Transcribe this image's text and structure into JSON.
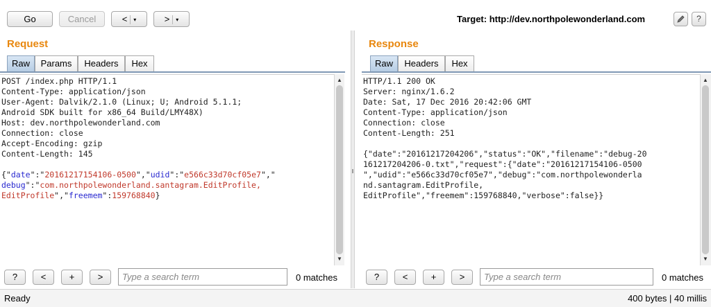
{
  "toolbar": {
    "go_label": "Go",
    "cancel_label": "Cancel",
    "back_label": "<",
    "forward_label": ">",
    "dropdown_glyph": "▾",
    "target_text": "Target: http://dev.northpolewonderland.com",
    "edit_icon": "pencil-icon",
    "help_glyph": "?"
  },
  "request": {
    "title": "Request",
    "tabs": [
      "Raw",
      "Params",
      "Headers",
      "Hex"
    ],
    "active_tab": "Raw",
    "lines": [
      "POST /index.php HTTP/1.1",
      "Content-Type: application/json",
      "User-Agent: Dalvik/2.1.0 (Linux; U; Android 5.1.1;",
      "Android SDK built for x86_64 Build/LMY48X)",
      "Host: dev.northpolewonderland.com",
      "Connection: close",
      "Accept-Encoding: gzip",
      "Content-Length: 145"
    ],
    "body_tokens": {
      "open": "{\"",
      "k_date": "date",
      "sep1": "\":\"",
      "v_date": "20161217154106-0500",
      "sep2": "\",\"",
      "k_udid": "udid",
      "sep3": "\":\"",
      "v_udid": "e566c33d70cf05e7",
      "sep4": "\",\"",
      "k_debug": "debug",
      "sep5": "\":\"",
      "v_debug_1": "com.northpolewonderland.santagram.EditProfile,",
      "v_debug_2": "EditProfile",
      "sep6": "\",\"",
      "k_freemem": "freemem",
      "sep7": "\":",
      "v_freemem": "159768840",
      "close": "}"
    },
    "search": {
      "help": "?",
      "prev": "<",
      "add": "+",
      "next": ">",
      "placeholder": "Type a search term",
      "matches": "0 matches"
    }
  },
  "response": {
    "title": "Response",
    "tabs": [
      "Raw",
      "Headers",
      "Hex"
    ],
    "active_tab": "Raw",
    "lines": [
      "HTTP/1.1 200 OK",
      "Server: nginx/1.6.2",
      "Date: Sat, 17 Dec 2016 20:42:06 GMT",
      "Content-Type: application/json",
      "Connection: close",
      "Content-Length: 251",
      "",
      "{\"date\":\"20161217204206\",\"status\":\"OK\",\"filename\":\"debug-20",
      "161217204206-0.txt\",\"request\":{\"date\":\"20161217154106-0500",
      "\",\"udid\":\"e566c33d70cf05e7\",\"debug\":\"com.northpolewonderla",
      "nd.santagram.EditProfile,",
      "EditProfile\",\"freemem\":159768840,\"verbose\":false}}"
    ],
    "search": {
      "help": "?",
      "prev": "<",
      "add": "+",
      "next": ">",
      "placeholder": "Type a search term",
      "matches": "0 matches"
    }
  },
  "status": {
    "left": "Ready",
    "right": "400 bytes | 40 millis"
  },
  "colors": {
    "accent_title": "#e8870e",
    "json_key": "#2a2ad0",
    "json_string": "#c0392b"
  }
}
